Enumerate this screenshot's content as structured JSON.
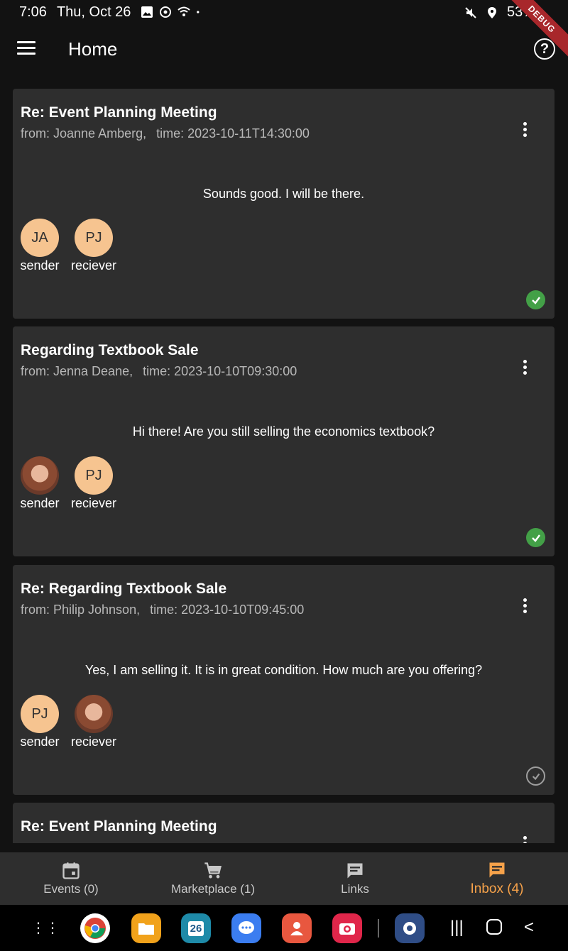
{
  "status": {
    "time": "7:06",
    "date": "Thu, Oct 26",
    "battery": "53%",
    "debug_label": "DEBUG"
  },
  "app_bar": {
    "title": "Home"
  },
  "messages": [
    {
      "title": "Re: Event Planning Meeting",
      "from": "from: Joanne Amberg,",
      "time": "time: 2023-10-11T14:30:00",
      "body": "Sounds good. I will be there.",
      "sender_initials": "JA",
      "receiver_initials": "PJ",
      "sender_label": "sender",
      "receiver_label": "reciever",
      "read": true
    },
    {
      "title": "Regarding Textbook Sale",
      "from": "from: Jenna Deane,",
      "time": "time: 2023-10-10T09:30:00",
      "body": "Hi there! Are you still selling the economics textbook?",
      "sender_initials": "",
      "receiver_initials": "PJ",
      "sender_label": "sender",
      "receiver_label": "reciever",
      "read": true
    },
    {
      "title": "Re: Regarding Textbook Sale",
      "from": "from: Philip Johnson,",
      "time": "time: 2023-10-10T09:45:00",
      "body": "Yes, I am selling it. It is in great condition. How much are you offering?",
      "sender_initials": "PJ",
      "receiver_initials": "",
      "sender_label": "sender",
      "receiver_label": "reciever",
      "read": false
    },
    {
      "title": "Re: Event Planning Meeting"
    }
  ],
  "bottom_nav": [
    {
      "label": "Events (0)",
      "icon": "calendar-icon"
    },
    {
      "label": "Marketplace (1)",
      "icon": "cart-icon"
    },
    {
      "label": "Links",
      "icon": "chat-icon"
    },
    {
      "label": "Inbox (4)",
      "icon": "inbox-icon",
      "active": true
    }
  ],
  "dock": {
    "calendar_day": "26"
  },
  "colors": {
    "accent": "#f6a24a",
    "avatar": "#f6c490",
    "check": "#43a047",
    "card": "#2e2e2e"
  }
}
